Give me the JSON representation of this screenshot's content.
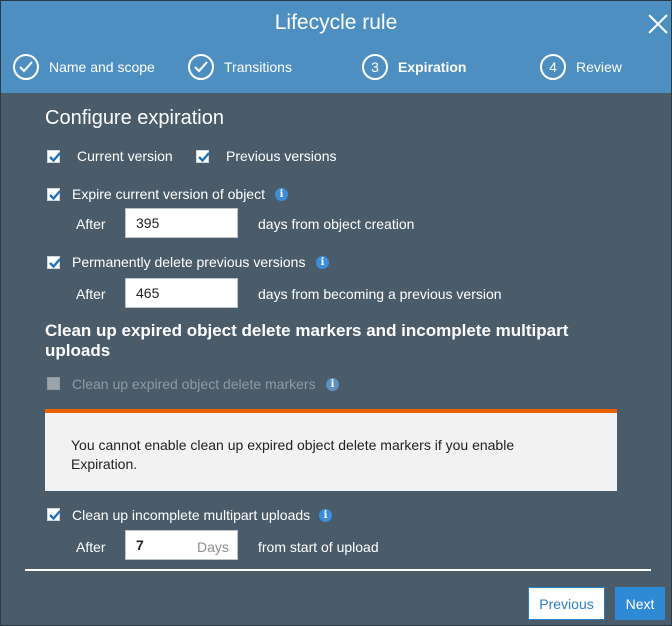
{
  "dialog": {
    "title": "Lifecycle rule",
    "close_icon": "close-icon"
  },
  "steps": [
    {
      "number": "",
      "label": "Name and scope",
      "state": "complete",
      "icon": "check-circle-icon"
    },
    {
      "number": "",
      "label": "Transitions",
      "state": "complete",
      "icon": "check-circle-icon"
    },
    {
      "number": "3",
      "label": "Expiration",
      "state": "active"
    },
    {
      "number": "4",
      "label": "Review",
      "state": "pending"
    }
  ],
  "expiration": {
    "heading": "Configure expiration",
    "current_version_label": "Current version",
    "current_version_checked": true,
    "previous_versions_label": "Previous versions",
    "previous_versions_checked": true,
    "expire_current": {
      "label": "Expire current version of object",
      "checked": true,
      "after_label": "After",
      "days_value": "395",
      "suffix": "days from object creation"
    },
    "delete_previous": {
      "label": "Permanently delete previous versions",
      "checked": true,
      "after_label": "After",
      "days_value": "465",
      "suffix": "days from becoming a previous version"
    }
  },
  "cleanup": {
    "heading": "Clean up expired object delete markers and incomplete multipart uploads",
    "delete_markers": {
      "label": "Clean up expired object delete markers",
      "checked": false,
      "disabled": true
    },
    "alert": {
      "message": "You cannot enable clean up expired object delete markers if you enable Expiration.",
      "accent_color": "#eb5f07"
    },
    "multipart": {
      "label": "Clean up incomplete multipart uploads",
      "checked": true,
      "after_label": "After",
      "days_value": "7",
      "unit": "Days",
      "suffix": "from start of upload"
    }
  },
  "footer": {
    "previous_label": "Previous",
    "next_label": "Next"
  },
  "colors": {
    "header_bg": "#4e8fc1",
    "body_bg": "#4a5c6a",
    "primary_button": "#2e8ad4",
    "info_icon": "#3d8ed8"
  }
}
